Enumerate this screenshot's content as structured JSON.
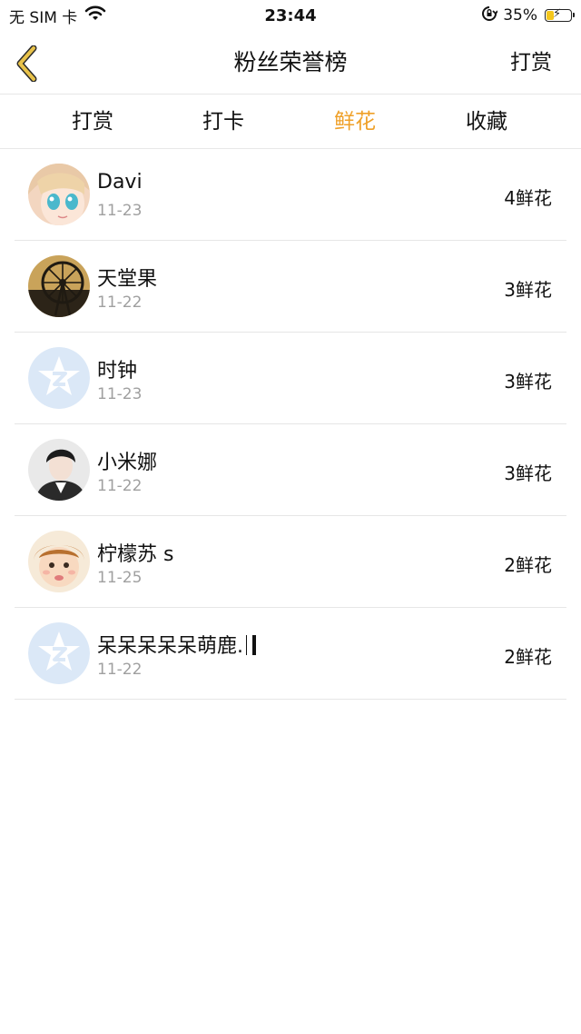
{
  "status_bar": {
    "carrier": "无 SIM 卡",
    "time": "23:44",
    "battery_percent_text": "35%",
    "battery_level": 0.35,
    "icons": [
      "wifi-icon",
      "orientation-lock-icon",
      "battery-charging-icon"
    ]
  },
  "nav": {
    "title": "粉丝荣誉榜",
    "back_icon": "chevron-left-icon",
    "action_label": "打赏"
  },
  "tabs": [
    {
      "label": "打赏",
      "active": false
    },
    {
      "label": "打卡",
      "active": false
    },
    {
      "label": "鲜花",
      "active": true
    },
    {
      "label": "收藏",
      "active": false
    }
  ],
  "colors": {
    "accent": "#efa028",
    "back_icon": "#e8c24a",
    "divider": "#e6e6e6",
    "date_text": "#a0a0a0"
  },
  "list": [
    {
      "name": "Davi",
      "date": "11-23",
      "count": "4鲜花",
      "avatar": "anime-girl-avatar"
    },
    {
      "name": "天堂果",
      "date": "11-22",
      "count": "3鲜花",
      "avatar": "ferris-wheel-avatar"
    },
    {
      "name": "时钟",
      "date": "11-23",
      "count": "3鲜花",
      "avatar": "default-qq-avatar"
    },
    {
      "name": "小米娜",
      "date": "11-22",
      "count": "3鲜花",
      "avatar": "man-portrait-avatar"
    },
    {
      "name": "柠檬苏 s",
      "date": "11-25",
      "count": "2鲜花",
      "avatar": "child-portrait-avatar"
    },
    {
      "name": "呆呆呆呆呆萌鹿.",
      "date": "11-22",
      "count": "2鲜花",
      "avatar": "default-qq-avatar"
    }
  ]
}
